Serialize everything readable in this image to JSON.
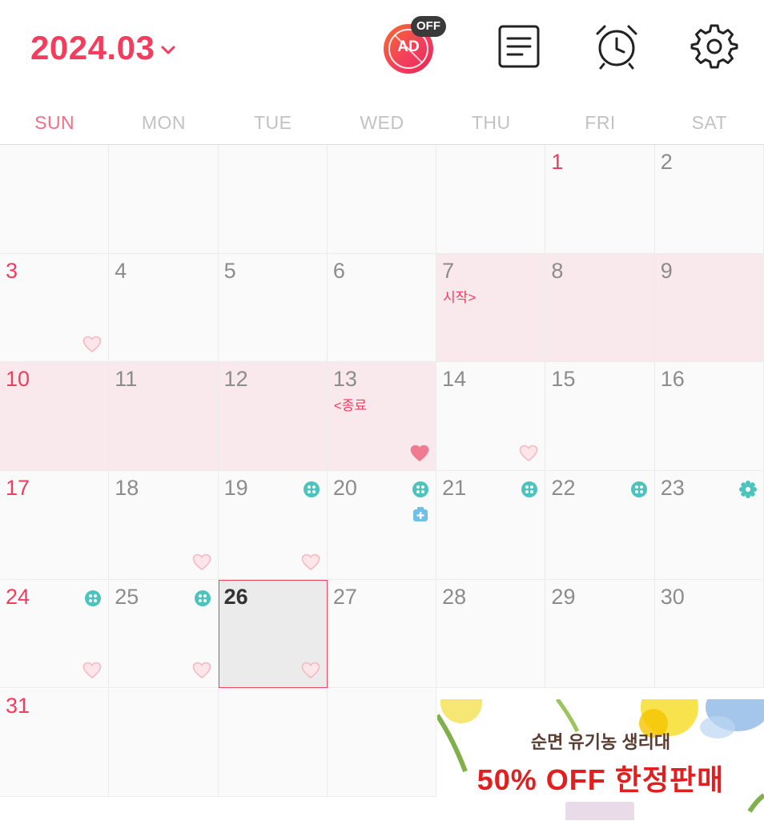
{
  "header": {
    "month_label": "2024.03",
    "ad_toggle": {
      "label": "AD",
      "badge": "OFF"
    }
  },
  "weekdays": [
    "SUN",
    "MON",
    "TUE",
    "WED",
    "THU",
    "FRI",
    "SAT"
  ],
  "calendar": {
    "notes": {
      "start": "시작>",
      "end": "<종료"
    },
    "days": [
      {
        "d": "",
        "c": 0,
        "r": 0
      },
      {
        "d": "",
        "c": 1,
        "r": 0
      },
      {
        "d": "",
        "c": 2,
        "r": 0
      },
      {
        "d": "",
        "c": 3,
        "r": 0
      },
      {
        "d": "",
        "c": 4,
        "r": 0
      },
      {
        "d": "1",
        "c": 5,
        "r": 0,
        "red": true
      },
      {
        "d": "2",
        "c": 6,
        "r": 0
      },
      {
        "d": "3",
        "c": 0,
        "r": 1,
        "red": true,
        "heart": "outline"
      },
      {
        "d": "4",
        "c": 1,
        "r": 1
      },
      {
        "d": "5",
        "c": 2,
        "r": 1
      },
      {
        "d": "6",
        "c": 3,
        "r": 1
      },
      {
        "d": "7",
        "c": 4,
        "r": 1,
        "period": true,
        "note": "start"
      },
      {
        "d": "8",
        "c": 5,
        "r": 1,
        "period": true
      },
      {
        "d": "9",
        "c": 6,
        "r": 1,
        "period": true
      },
      {
        "d": "10",
        "c": 0,
        "r": 2,
        "red": true,
        "period": true
      },
      {
        "d": "11",
        "c": 1,
        "r": 2,
        "period": true
      },
      {
        "d": "12",
        "c": 2,
        "r": 2,
        "period": true
      },
      {
        "d": "13",
        "c": 3,
        "r": 2,
        "period": true,
        "note": "end",
        "heart": "filled"
      },
      {
        "d": "14",
        "c": 4,
        "r": 2,
        "heart": "outline"
      },
      {
        "d": "15",
        "c": 5,
        "r": 2
      },
      {
        "d": "16",
        "c": 6,
        "r": 2
      },
      {
        "d": "17",
        "c": 0,
        "r": 3,
        "red": true
      },
      {
        "d": "18",
        "c": 1,
        "r": 3,
        "heart": "outline"
      },
      {
        "d": "19",
        "c": 2,
        "r": 3,
        "heart": "outline",
        "pill": true
      },
      {
        "d": "20",
        "c": 3,
        "r": 3,
        "pill": true,
        "med": true
      },
      {
        "d": "21",
        "c": 4,
        "r": 3,
        "pill": true
      },
      {
        "d": "22",
        "c": 5,
        "r": 3,
        "pill": true
      },
      {
        "d": "23",
        "c": 6,
        "r": 3,
        "gear": true
      },
      {
        "d": "24",
        "c": 0,
        "r": 4,
        "red": true,
        "pill": true,
        "heart": "outline"
      },
      {
        "d": "25",
        "c": 1,
        "r": 4,
        "pill": true,
        "heart": "outline"
      },
      {
        "d": "26",
        "c": 2,
        "r": 4,
        "today": true,
        "heart": "outline"
      },
      {
        "d": "27",
        "c": 3,
        "r": 4
      },
      {
        "d": "28",
        "c": 4,
        "r": 4
      },
      {
        "d": "29",
        "c": 5,
        "r": 4
      },
      {
        "d": "30",
        "c": 6,
        "r": 4
      },
      {
        "d": "31",
        "c": 0,
        "r": 5,
        "red": true
      },
      {
        "d": "",
        "c": 1,
        "r": 5
      },
      {
        "d": "",
        "c": 2,
        "r": 5
      },
      {
        "d": "",
        "c": 3,
        "r": 5
      }
    ]
  },
  "ad_banner": {
    "subtitle": "순면 유기농 생리대",
    "headline": "50% OFF 한정판매"
  },
  "colors": {
    "accent": "#f23d5f",
    "period_bg": "#fae9ec",
    "pill": "#4cc3bd",
    "med": "#6fc0e8",
    "heart_outline": "#f7b8c2",
    "heart_filled": "#f07a90"
  }
}
